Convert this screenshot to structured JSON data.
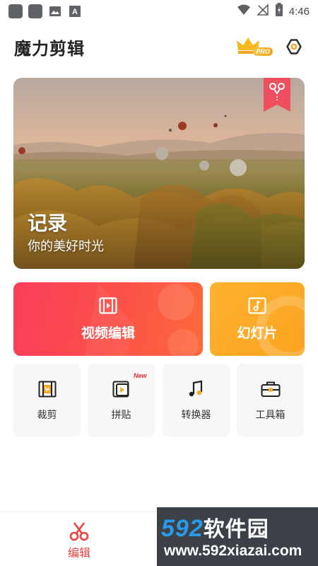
{
  "status_bar": {
    "time": "4:46"
  },
  "header": {
    "title": "魔力剪辑",
    "pro_label": "PRO"
  },
  "hero": {
    "title": "记录",
    "subtitle": "你的美好时光"
  },
  "cards": {
    "video_edit": {
      "label": "视频编辑",
      "icon": "film-icon"
    },
    "slideshow": {
      "label": "幻灯片",
      "icon": "music-note-icon"
    }
  },
  "tools": [
    {
      "label": "裁剪",
      "icon": "crop-film-icon"
    },
    {
      "label": "拼贴",
      "icon": "collage-play-icon",
      "badge": "New"
    },
    {
      "label": "转换器",
      "icon": "music-converter-icon"
    },
    {
      "label": "工具箱",
      "icon": "toolbox-icon"
    }
  ],
  "bottom_nav": {
    "edit_label": "编辑"
  },
  "watermark": {
    "brand_num": "592",
    "brand_text": "软件园",
    "url": "www.592xiazai.com"
  }
}
